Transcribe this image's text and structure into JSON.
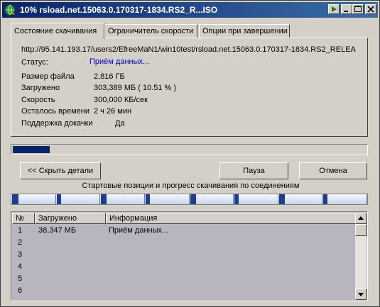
{
  "window": {
    "title": "10% rsload.net.15063.0.170317-1834.RS2_R...ISO",
    "buttons": [
      "run-icon",
      "minimize-icon",
      "maximize-icon",
      "close-icon"
    ]
  },
  "tabs": [
    {
      "label": "Состояние скачивания",
      "active": true
    },
    {
      "label": "Ограничитель скорости",
      "active": false
    },
    {
      "label": "Опции при завершении",
      "active": false
    }
  ],
  "status_panel": {
    "url": "http://95.141.193.17/users2/EfreeMaN1/win10test/rsload.net.15063.0.170317-1834.RS2_RELEA",
    "status_label": "Статус:",
    "status_value": "Приём данных...",
    "rows": [
      {
        "label": "Размер файла",
        "value": "2,816  ГБ"
      },
      {
        "label": "Загружено",
        "value": "303,389  МБ  ( 10.51 % )"
      },
      {
        "label": "Скорость",
        "value": "300,000  КБ/сек"
      },
      {
        "label": "Осталось времени",
        "value": "2 ч 26 мин"
      },
      {
        "label": "Поддержка докачки",
        "value": "Да"
      }
    ]
  },
  "progress": {
    "percent": 10.51,
    "color": "#0a246a"
  },
  "buttons": {
    "hide_details": "<< Скрыть детали",
    "pause": "Пауза",
    "cancel": "Отмена"
  },
  "connections": {
    "caption": "Стартовые позиции и прогресс скачивания по соединениям",
    "segments": 8,
    "progress_fractions": [
      0.06,
      0.01,
      0.05,
      0.01,
      0.05,
      0.01,
      0.05,
      0.01
    ]
  },
  "list": {
    "columns": [
      "№",
      "Загружено",
      "Информация"
    ],
    "rows": [
      {
        "num": "1",
        "loaded": "38,347  МБ",
        "info": "Приём данных..."
      },
      {
        "num": "2",
        "loaded": "",
        "info": ""
      },
      {
        "num": "3",
        "loaded": "",
        "info": ""
      },
      {
        "num": "4",
        "loaded": "",
        "info": ""
      },
      {
        "num": "5",
        "loaded": "",
        "info": ""
      },
      {
        "num": "6",
        "loaded": "",
        "info": ""
      }
    ]
  }
}
